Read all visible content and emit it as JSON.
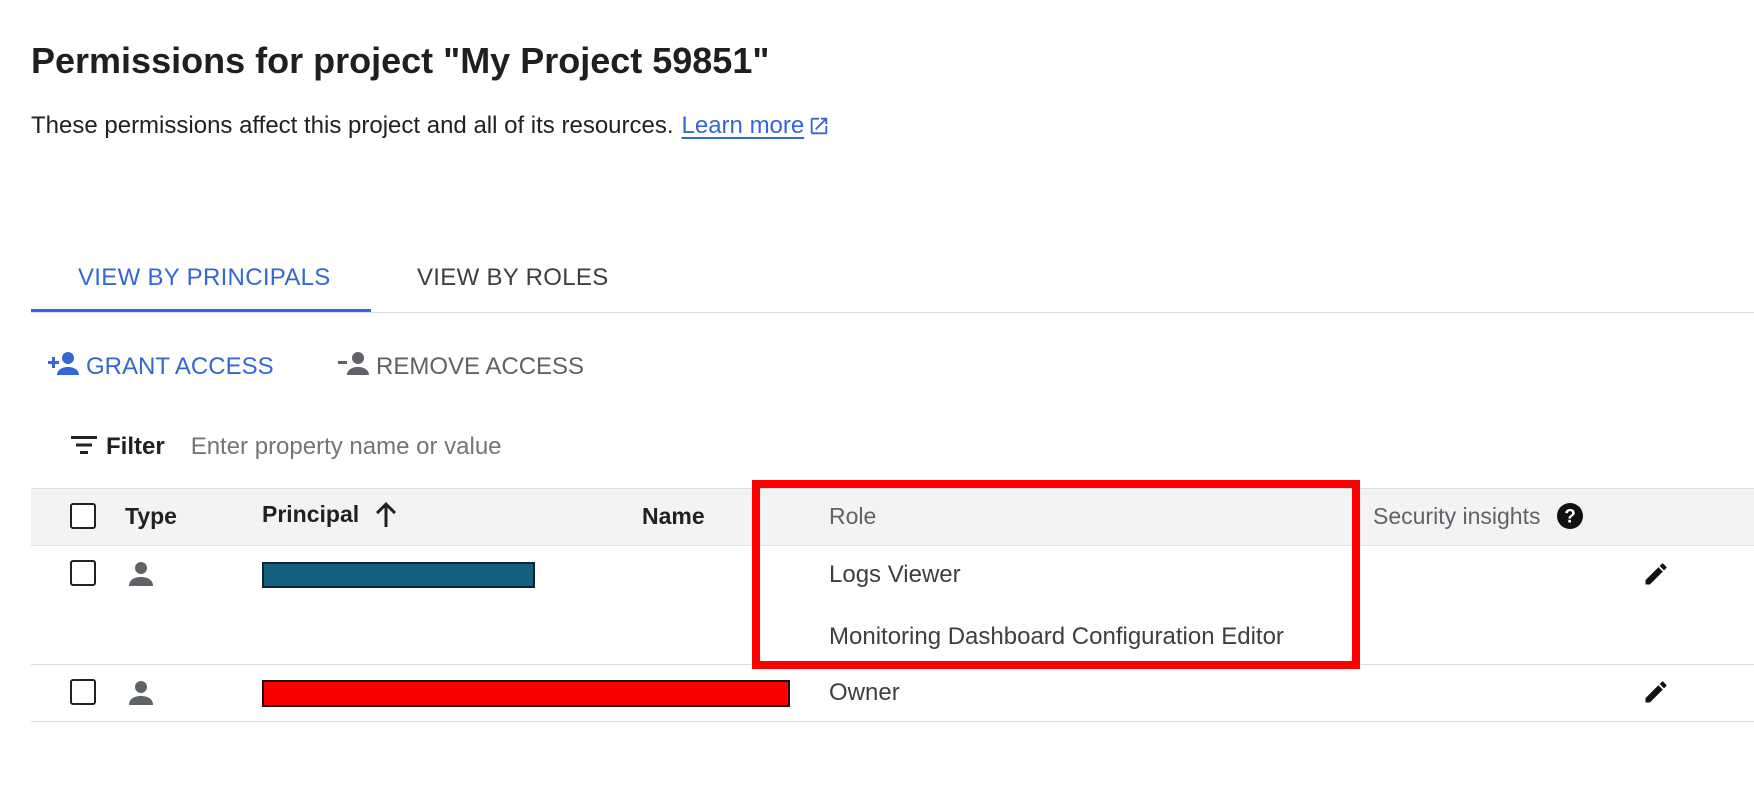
{
  "header": {
    "title": "Permissions for project \"My Project 59851\"",
    "subtitle": "These permissions affect this project and all of its resources.",
    "learn_more": "Learn more"
  },
  "tabs": [
    {
      "label": "VIEW BY PRINCIPALS",
      "active": true
    },
    {
      "label": "VIEW BY ROLES",
      "active": false
    }
  ],
  "actions": {
    "grant_label": "GRANT ACCESS",
    "remove_label": "REMOVE ACCESS"
  },
  "filter": {
    "label": "Filter",
    "placeholder": "Enter property name or value"
  },
  "table": {
    "columns": {
      "type": "Type",
      "principal": "Principal",
      "name": "Name",
      "role": "Role",
      "security_insights": "Security insights"
    },
    "rows": [
      {
        "roles": [
          "Logs Viewer",
          "Monitoring Dashboard Configuration Editor"
        ]
      },
      {
        "roles": [
          "Owner"
        ]
      }
    ]
  },
  "colors": {
    "accent": "#3367d6",
    "highlight_box": "#ff0000",
    "redact_blue": "#14617f",
    "redact_red": "#fb0000"
  },
  "icons": [
    "external-link-icon",
    "person-add-icon",
    "person-remove-icon",
    "filter-icon",
    "sort-arrow-up-icon",
    "help-icon",
    "person-icon",
    "edit-pencil-icon"
  ]
}
